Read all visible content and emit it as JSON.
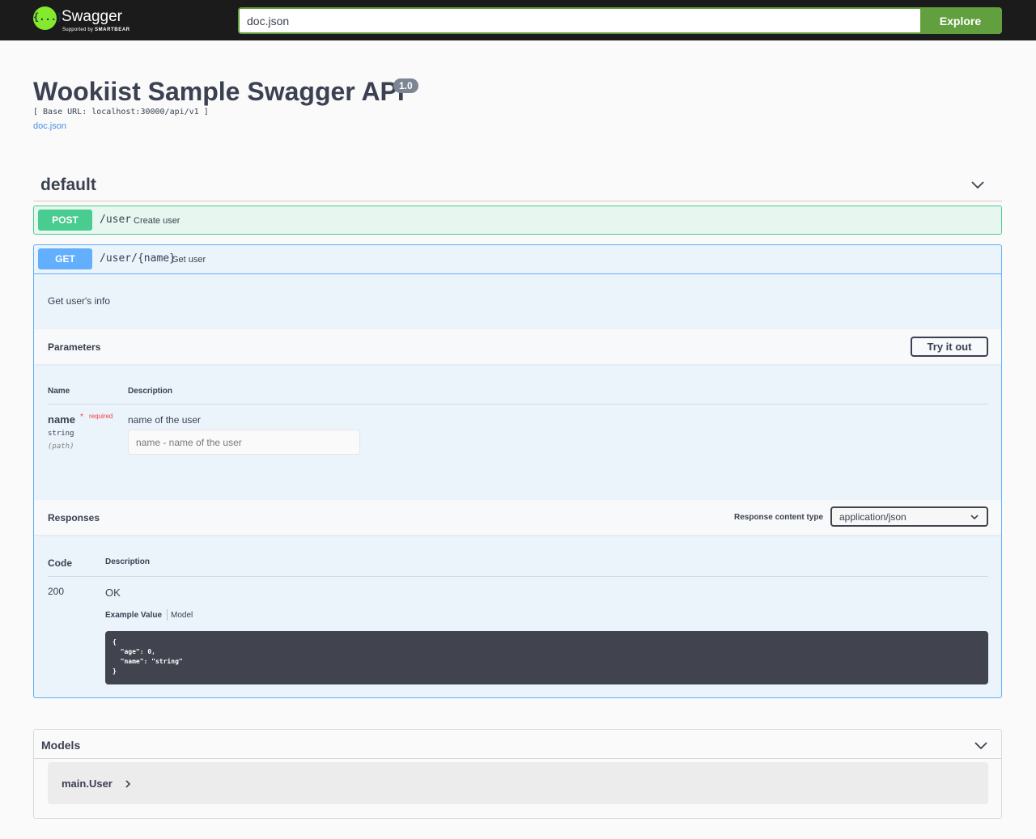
{
  "topbar": {
    "logo_text": "Swagger",
    "logo_sub_prefix": "Supported by",
    "logo_sub_brand": "SMARTBEAR",
    "logo_glyph": "{...}",
    "search_value": "doc.json",
    "explore_label": "Explore"
  },
  "info": {
    "title": "Wookiist Sample Swagger API",
    "version": "1.0",
    "base_url": "[ Base URL: localhost:30000/api/v1 ]",
    "doc_link": "doc.json"
  },
  "tag": {
    "name": "default"
  },
  "operations": {
    "post_user": {
      "method": "POST",
      "path": "/user",
      "summary": "Create user"
    },
    "get_user": {
      "method": "GET",
      "path": "/user/{name}",
      "summary": "Get user",
      "description": "Get user's info",
      "parameters_label": "Parameters",
      "try_label": "Try it out",
      "col_name": "Name",
      "col_description": "Description",
      "param": {
        "name": "name",
        "star": "*",
        "required_label": "required",
        "type": "string",
        "in": "(path)",
        "description": "name of the user",
        "placeholder": "name - name of the user"
      },
      "responses_label": "Responses",
      "response_content_type_label": "Response content type",
      "response_content_type": "application/json",
      "col_code": "Code",
      "col_resp_description": "Description",
      "response": {
        "code": "200",
        "description": "OK",
        "tab_example": "Example Value",
        "tab_model": "Model",
        "example": "{\n  \"age\": 0,\n  \"name\": \"string\"\n}"
      }
    }
  },
  "models": {
    "title": "Models",
    "items": [
      "main.User"
    ]
  },
  "colors": {
    "post": "#49cc90",
    "get": "#61affe",
    "accent": "#62a03f",
    "logo": "#85ea2d"
  }
}
